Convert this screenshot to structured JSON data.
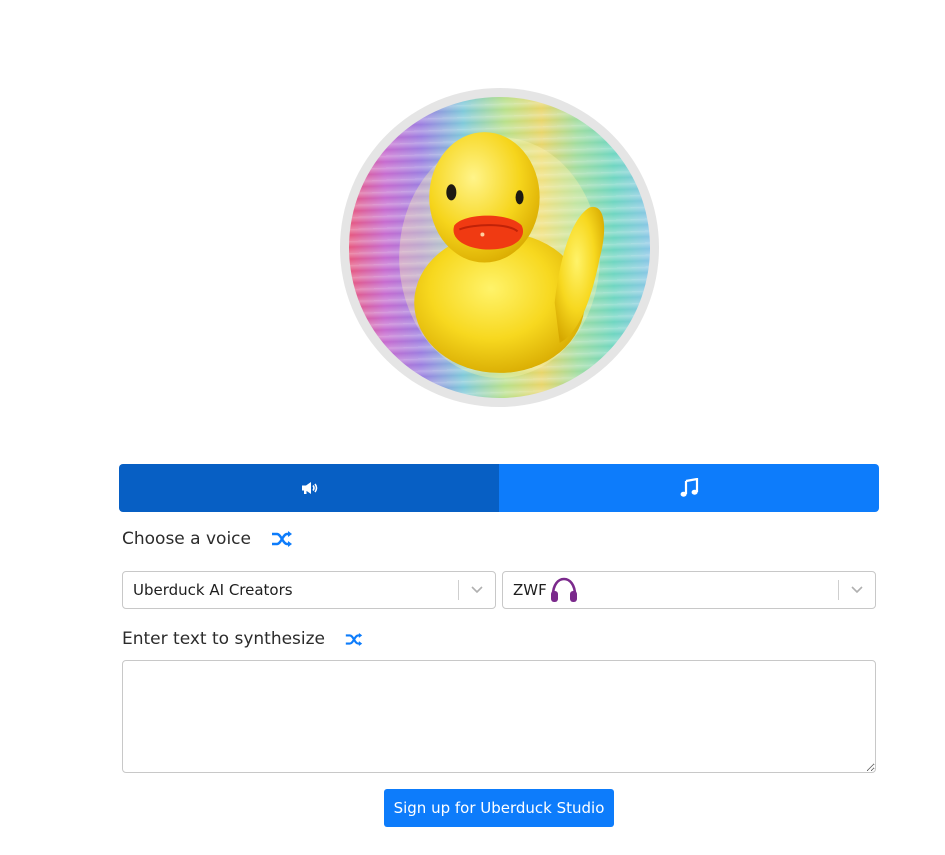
{
  "avatar": {
    "icon": "rubber-duck-avatar"
  },
  "mode_tabs": [
    {
      "icon": "megaphone-icon",
      "active": true
    },
    {
      "icon": "music-note-icon",
      "active": false
    }
  ],
  "voice_section": {
    "label": "Choose a voice",
    "shuffle_icon": "shuffle-icon",
    "category_select": {
      "value": "Uberduck AI Creators"
    },
    "voice_select": {
      "value": "ZWF",
      "badge_icon": "headphones-icon",
      "badge_color": "#7b2a8c"
    }
  },
  "text_section": {
    "label": "Enter text to synthesize",
    "shuffle_icon": "shuffle-icon",
    "textarea": {
      "value": "",
      "placeholder": ""
    }
  },
  "signup_button": {
    "label": "Sign up for Uberduck Studio"
  },
  "colors": {
    "primary": "#0d7cfb",
    "primary_active": "#075fc4"
  }
}
